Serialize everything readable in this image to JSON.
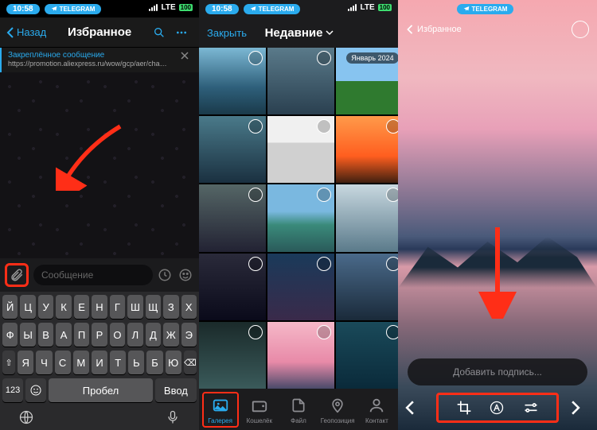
{
  "status": {
    "time": "10:58",
    "app_pill": "TELEGRAM",
    "network": "LTE",
    "battery": "100"
  },
  "screen1": {
    "back": "Назад",
    "title": "Избранное",
    "pinned_title": "Закреплённое сообщение",
    "pinned_url": "https://promotion.aliexpress.ru/wow/gcp/aer/chann...",
    "placeholder": "Сообщение",
    "keyboard": {
      "row1": [
        "Й",
        "Ц",
        "У",
        "К",
        "Е",
        "Н",
        "Г",
        "Ш",
        "Щ",
        "З",
        "Х"
      ],
      "row2": [
        "Ф",
        "Ы",
        "В",
        "А",
        "П",
        "Р",
        "О",
        "Л",
        "Д",
        "Ж",
        "Э"
      ],
      "row3": [
        "Я",
        "Ч",
        "С",
        "М",
        "И",
        "Т",
        "Ь",
        "Б",
        "Ю"
      ],
      "shift": "⇧",
      "backspace": "⌫",
      "numbers": "123",
      "space": "Пробел",
      "enter": "Ввод"
    }
  },
  "screen2": {
    "close": "Закрыть",
    "title": "Недавние",
    "date_badge": "Январь 2024",
    "tabs": [
      {
        "key": "gallery",
        "label": "Галерея"
      },
      {
        "key": "wallet",
        "label": "Кошелёк"
      },
      {
        "key": "file",
        "label": "Файл"
      },
      {
        "key": "location",
        "label": "Геопозиция"
      },
      {
        "key": "contact",
        "label": "Контакт"
      }
    ]
  },
  "screen3": {
    "breadcrumb": "Избранное",
    "caption_placeholder": "Добавить подпись..."
  },
  "colors": {
    "accent": "#2aabee",
    "highlight": "#ff2e17"
  }
}
